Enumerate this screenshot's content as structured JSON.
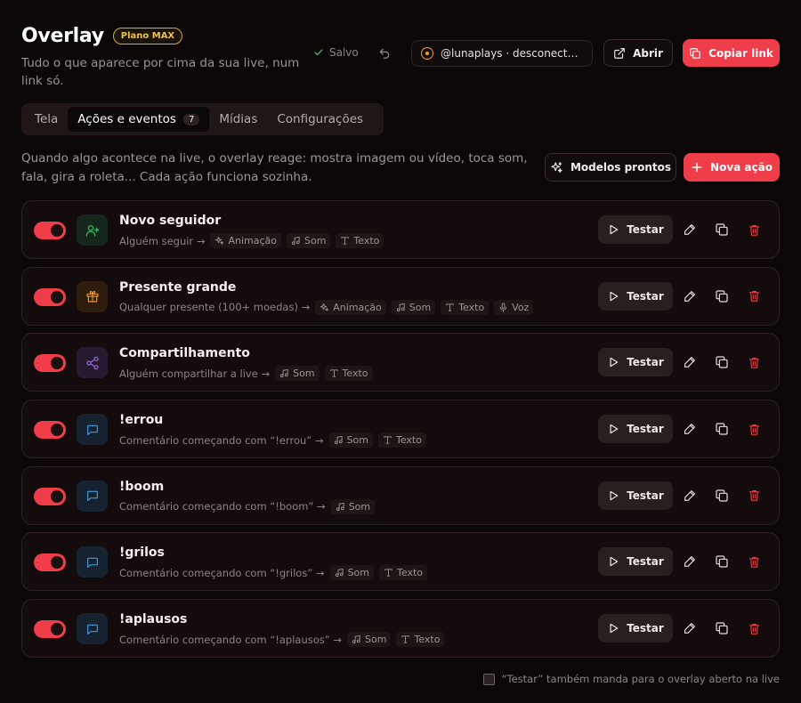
{
  "header": {
    "title": "Overlay",
    "plan_badge": "Plano MAX",
    "subtitle": "Tudo o que aparece por cima da sua live, num link só.",
    "saved_label": "Salvo",
    "status": "@lunaplays · desconectado",
    "open_label": "Abrir",
    "copy_link_label": "Copiar link"
  },
  "tabs": [
    {
      "label": "Tela",
      "active": false
    },
    {
      "label": "Ações e eventos",
      "active": true,
      "count": "7"
    },
    {
      "label": "Mídias",
      "active": false
    },
    {
      "label": "Configurações",
      "active": false
    }
  ],
  "intro": "Quando algo acontece na live, o overlay reage: mostra imagem ou vídeo, toca som, fala, gira a roleta... Cada ação funciona sozinha.",
  "toolbar": {
    "templates_label": "Modelos prontos",
    "new_action_label": "Nova ação"
  },
  "actions": [
    {
      "title": "Novo seguidor",
      "trigger": "Alguém seguir →",
      "icon": "user-plus-icon",
      "icon_color": "#3fbf6a",
      "icon_bg": "#15271a",
      "enabled": true,
      "chips": [
        {
          "label": "Animação",
          "icon": "sparkle"
        },
        {
          "label": "Som",
          "icon": "music"
        },
        {
          "label": "Texto",
          "icon": "text"
        }
      ]
    },
    {
      "title": "Presente grande",
      "trigger": "Qualquer presente (100+ moedas) →",
      "icon": "gift-icon",
      "icon_color": "#e8952a",
      "icon_bg": "#2e1c0c",
      "enabled": true,
      "chips": [
        {
          "label": "Animação",
          "icon": "sparkle"
        },
        {
          "label": "Som",
          "icon": "music"
        },
        {
          "label": "Texto",
          "icon": "text"
        },
        {
          "label": "Voz",
          "icon": "mic"
        }
      ]
    },
    {
      "title": "Compartilhamento",
      "trigger": "Alguém compartilhar a live →",
      "icon": "share-icon",
      "icon_color": "#a06ad8",
      "icon_bg": "#251a30",
      "enabled": true,
      "chips": [
        {
          "label": "Som",
          "icon": "music"
        },
        {
          "label": "Texto",
          "icon": "text"
        }
      ]
    },
    {
      "title": "!errou",
      "trigger": "Comentário começando com “!errou” →",
      "icon": "chat-icon",
      "icon_color": "#3f9ad8",
      "icon_bg": "#162230",
      "enabled": true,
      "chips": [
        {
          "label": "Som",
          "icon": "music"
        },
        {
          "label": "Texto",
          "icon": "text"
        }
      ]
    },
    {
      "title": "!boom",
      "trigger": "Comentário começando com “!boom” →",
      "icon": "chat-icon",
      "icon_color": "#3f9ad8",
      "icon_bg": "#162230",
      "enabled": true,
      "chips": [
        {
          "label": "Som",
          "icon": "music"
        }
      ]
    },
    {
      "title": "!grilos",
      "trigger": "Comentário começando com “!grilos” →",
      "icon": "chat-icon",
      "icon_color": "#3f9ad8",
      "icon_bg": "#162230",
      "enabled": true,
      "chips": [
        {
          "label": "Som",
          "icon": "music"
        },
        {
          "label": "Texto",
          "icon": "text"
        }
      ]
    },
    {
      "title": "!aplausos",
      "trigger": "Comentário começando com “!aplausos” →",
      "icon": "chat-icon",
      "icon_color": "#3f9ad8",
      "icon_bg": "#162230",
      "enabled": true,
      "chips": [
        {
          "label": "Som",
          "icon": "music"
        },
        {
          "label": "Texto",
          "icon": "text"
        }
      ]
    }
  ],
  "test_label": "Testar",
  "footer": {
    "checkbox_label": "“Testar” também manda para o overlay aberto na live",
    "checked": false
  },
  "colors": {
    "accent": "#ef3e4a",
    "background": "#0b0707",
    "plan_badge": "#f0c14b",
    "status_ring": "#f0a020"
  }
}
